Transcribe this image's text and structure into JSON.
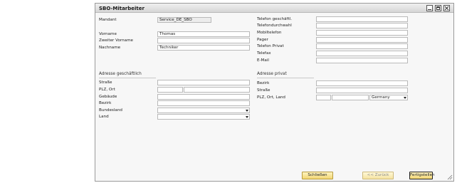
{
  "window": {
    "title": "SBO-Mitarbeiter"
  },
  "left": {
    "mandant_label": "Mandant",
    "mandant_value": "Service_DE_SBO",
    "vorname_label": "Vorname",
    "vorname_value": "Thomas",
    "zweiter_label": "Zweiter Vorname",
    "zweiter_value": "",
    "nachname_label": "Nachname",
    "nachname_value": "Techniker"
  },
  "right": {
    "telefon_geschaeftl": "Telefon geschäftl.",
    "telefondurchwahl": "Telefondurchwahl",
    "mobiltelefon": "Mobiltelefon",
    "pager": "Pager",
    "telefon_privat": "Telefon Privat",
    "telefax": "Telefax",
    "email": "E-Mail"
  },
  "business": {
    "heading": "Adresse geschäftlich",
    "strasse": "Straße",
    "plz_ort": "PLZ, Ort",
    "gebaeude": "Gebäude",
    "bezirk": "Bezirk",
    "bundesland": "Bundesland",
    "land": "Land"
  },
  "private": {
    "heading": "Adresse privat",
    "bezirk": "Bezirk",
    "strasse": "Straße",
    "plz_ort_land": "PLZ, Ort, Land",
    "land_value": "Germany"
  },
  "buttons": {
    "schliessen": "Schließen",
    "zurueck": "<< Zurück",
    "fertigstellen": "Fertigstellen"
  }
}
